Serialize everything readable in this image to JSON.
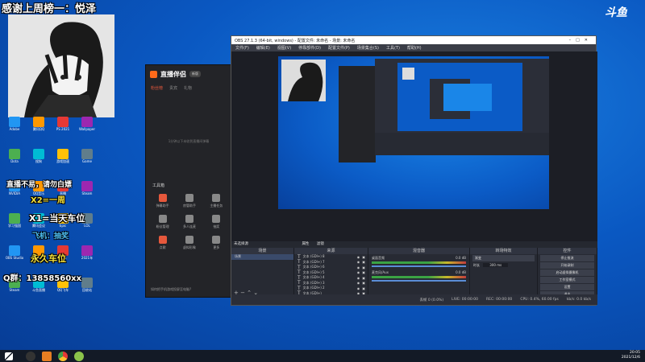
{
  "stream_overlay": {
    "title": "感谢上周榜一：悦泽",
    "lines": [
      "直播不易，请勿白嫖",
      "X2=一周",
      "X1=当天车位",
      "飞机：抽奖",
      "永久车位",
      "Q群：13858560xx"
    ]
  },
  "platform_logo": "斗鱼",
  "desktop_icons": [
    "Adobe",
    "腾讯QQ",
    "PS 2021",
    "Wallpaper",
    "Dota",
    "搜狗",
    "游戏加速",
    "Game",
    "NVIDIA",
    "QQ音乐",
    "直播",
    "Steam",
    "学习强国",
    "腾讯会议",
    "Epic",
    "LOL",
    "OBS Studio",
    "OneDrive",
    "WPS",
    "2021年",
    "Steam",
    "斗鱼直播",
    "QQ飞车",
    "回收站"
  ],
  "helper_app": {
    "logo_text": "直播伴侣",
    "badge": "新版",
    "tabs": [
      "粉丝榜",
      "贵宾",
      "礼物"
    ],
    "empty_text": "1分钟以下未收到直播间弹幕",
    "toolbox_title": "工具箱",
    "tools": [
      "弹幕助手",
      "房管助手",
      "主播任务",
      "粉丝管理",
      "多人连麦",
      "抽奖",
      "点歌",
      "虚拟形象",
      "更多"
    ],
    "bottom_tip": "如何把手机游戏投屏至电脑?"
  },
  "obs": {
    "title": "OBS 27.1.3 (64-bit, windows) - 配置文件: 未命名 - 场景: 未命名",
    "menu": [
      "文件(F)",
      "编辑(E)",
      "视图(V)",
      "停靠部件(D)",
      "配置文件(P)",
      "场景集合(S)",
      "工具(T)",
      "帮助(H)"
    ],
    "no_source": "未选择源",
    "props_btn": "属性",
    "filters_btn": "滤镜",
    "scenes_title": "场景",
    "scene_item": "场景",
    "sources_title": "来源",
    "sources": [
      "文本 (GDI+) 8",
      "文本 (GDI+) 7",
      "文本 (GDI+) 6",
      "文本 (GDI+) 5",
      "文本 (GDI+) 4",
      "文本 (GDI+) 3",
      "文本 (GDI+) 2",
      "文本 (GDI+)"
    ],
    "mixer_title": "混音器",
    "mixer_channels": [
      {
        "name": "桌面音频",
        "db": "0.0 dB"
      },
      {
        "name": "麦克风/Aux",
        "db": "0.0 dB"
      }
    ],
    "transition_title": "转场特效",
    "transition_type": "渐变",
    "duration_label": "时长",
    "duration_value": "300 ms",
    "controls_title": "控件",
    "controls": [
      "停止推流",
      "开始录制",
      "启动虚拟摄像机",
      "工作室模式",
      "设置",
      "退出"
    ],
    "status": {
      "dropped": "丢帧 0 (0.0%)",
      "live": "LIVE: 00:00:00",
      "rec": "REC: 00:00:00",
      "cpu": "CPU: 0.4%, 60.00 fps",
      "kbps": "kb/s: 0.0 kb/s"
    }
  },
  "taskbar": {
    "time": "20:05",
    "date": "2021/12/6"
  }
}
